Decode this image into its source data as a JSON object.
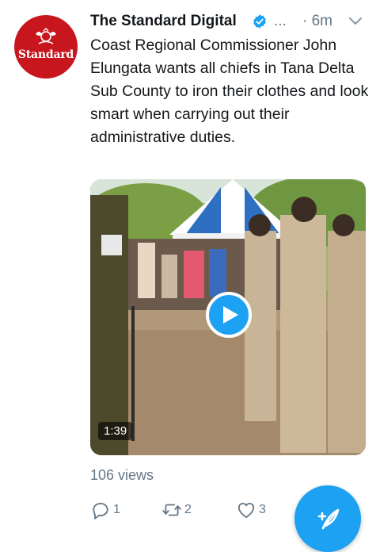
{
  "account": {
    "display_name": "The Standard Digital",
    "verified": true,
    "more_indicator": "...",
    "time": "· 6m",
    "avatar_logo_text": "Standard",
    "avatar_color": "#c8161e"
  },
  "tweet": {
    "text": "Coast Regional Commissioner John Elungata wants all chiefs in Tana Delta Sub County to iron their clothes and look smart when carrying out their administrative duties."
  },
  "media": {
    "type": "video",
    "duration": "1:39",
    "play_icon": "play-icon"
  },
  "views": "106 views",
  "actions": {
    "reply_count": "1",
    "retweet_count": "2",
    "like_count": "3"
  },
  "compose_fab": {
    "icon": "compose-feather-icon"
  },
  "colors": {
    "accent": "#1da1f2",
    "text": "#14171a",
    "secondary_text": "#657786"
  }
}
